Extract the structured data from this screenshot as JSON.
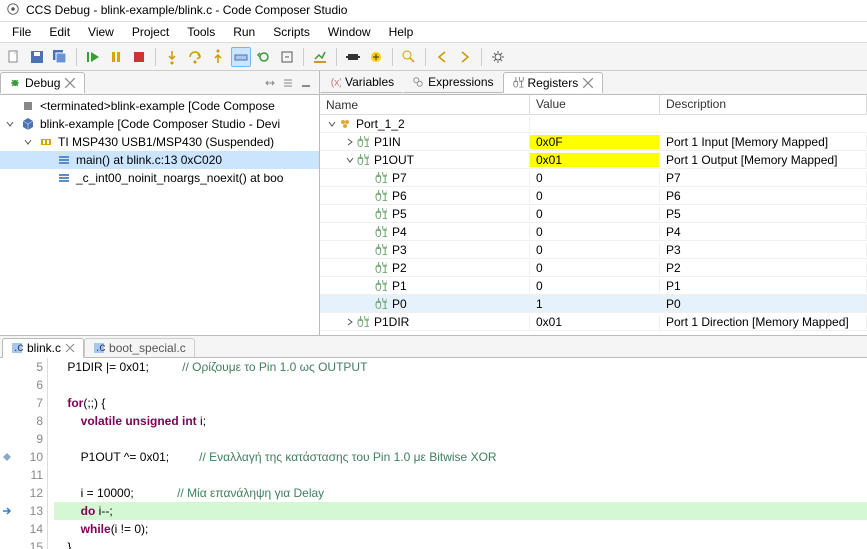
{
  "title": "CCS Debug - blink-example/blink.c - Code Composer Studio",
  "menu": [
    "File",
    "Edit",
    "View",
    "Project",
    "Tools",
    "Run",
    "Scripts",
    "Window",
    "Help"
  ],
  "debug_view": {
    "title": "Debug",
    "tree": [
      {
        "depth": 0,
        "chev": "",
        "icon": "cube-term",
        "label": "<terminated>blink-example [Code Compose"
      },
      {
        "depth": 0,
        "chev": "down",
        "icon": "cube",
        "label": "blink-example [Code Composer Studio - Devi"
      },
      {
        "depth": 1,
        "chev": "down",
        "icon": "chip-pause",
        "label": "TI MSP430 USB1/MSP430 (Suspended)"
      },
      {
        "depth": 2,
        "chev": "",
        "icon": "stack",
        "label": "main() at blink.c:13 0xC020",
        "selected": true
      },
      {
        "depth": 2,
        "chev": "",
        "icon": "stack",
        "label": "_c_int00_noinit_noargs_noexit() at boo"
      }
    ]
  },
  "vars_tabs": {
    "items": [
      {
        "label": "Variables",
        "icon": "vars"
      },
      {
        "label": "Expressions",
        "icon": "expr"
      },
      {
        "label": "Registers",
        "icon": "regs",
        "active": true
      }
    ]
  },
  "registers": {
    "cols": {
      "name": "Name",
      "value": "Value",
      "desc": "Description"
    },
    "rows": [
      {
        "depth": 0,
        "chev": "down",
        "icon": "group",
        "name": "Port_1_2",
        "value": "",
        "desc": ""
      },
      {
        "depth": 1,
        "chev": "right",
        "icon": "reg",
        "name": "P1IN",
        "value": "0x0F",
        "desc": "Port 1 Input [Memory Mapped]",
        "hl": true
      },
      {
        "depth": 1,
        "chev": "down",
        "icon": "reg",
        "name": "P1OUT",
        "value": "0x01",
        "desc": "Port 1 Output [Memory Mapped]",
        "hl": true
      },
      {
        "depth": 2,
        "icon": "reg",
        "name": "P7",
        "value": "0",
        "desc": "P7"
      },
      {
        "depth": 2,
        "icon": "reg",
        "name": "P6",
        "value": "0",
        "desc": "P6"
      },
      {
        "depth": 2,
        "icon": "reg",
        "name": "P5",
        "value": "0",
        "desc": "P5"
      },
      {
        "depth": 2,
        "icon": "reg",
        "name": "P4",
        "value": "0",
        "desc": "P4"
      },
      {
        "depth": 2,
        "icon": "reg",
        "name": "P3",
        "value": "0",
        "desc": "P3"
      },
      {
        "depth": 2,
        "icon": "reg",
        "name": "P2",
        "value": "0",
        "desc": "P2"
      },
      {
        "depth": 2,
        "icon": "reg",
        "name": "P1",
        "value": "0",
        "desc": "P1"
      },
      {
        "depth": 2,
        "icon": "reg",
        "name": "P0",
        "value": "1",
        "desc": "P0",
        "sel": true
      },
      {
        "depth": 1,
        "chev": "right",
        "icon": "reg",
        "name": "P1DIR",
        "value": "0x01",
        "desc": "Port 1 Direction [Memory Mapped]"
      }
    ]
  },
  "editor": {
    "tabs": [
      {
        "label": "blink.c",
        "active": true,
        "closable": true
      },
      {
        "label": "boot_special.c",
        "active": false
      }
    ],
    "first_line": 5,
    "lines": [
      {
        "n": 5,
        "mark": "",
        "tokens": [
          {
            "t": "    P1DIR |= 0x01;",
            "c": "op"
          },
          {
            "t": "          ",
            "c": ""
          },
          {
            "t": "// Ορίζουμε το Pin 1.0 ως OUTPUT",
            "c": "comment"
          }
        ]
      },
      {
        "n": 6,
        "mark": "",
        "tokens": [
          {
            "t": "",
            "c": ""
          }
        ]
      },
      {
        "n": 7,
        "mark": "",
        "tokens": [
          {
            "t": "    ",
            "c": ""
          },
          {
            "t": "for",
            "c": "kw"
          },
          {
            "t": "(;;) {",
            "c": "op"
          }
        ]
      },
      {
        "n": 8,
        "mark": "",
        "tokens": [
          {
            "t": "        ",
            "c": ""
          },
          {
            "t": "volatile unsigned int",
            "c": "kw"
          },
          {
            "t": " i;",
            "c": "op"
          }
        ]
      },
      {
        "n": 9,
        "mark": "",
        "tokens": [
          {
            "t": "",
            "c": ""
          }
        ]
      },
      {
        "n": 10,
        "mark": "diamond",
        "tokens": [
          {
            "t": "        P1OUT ^= 0x01;",
            "c": "op"
          },
          {
            "t": "         ",
            "c": ""
          },
          {
            "t": "// Εναλλαγή της κατάστασης του Pin 1.0 με Bitwise XOR",
            "c": "comment"
          }
        ]
      },
      {
        "n": 11,
        "mark": "",
        "tokens": [
          {
            "t": "",
            "c": ""
          }
        ]
      },
      {
        "n": 12,
        "mark": "",
        "tokens": [
          {
            "t": "        i = 10000;",
            "c": "op"
          },
          {
            "t": "             ",
            "c": ""
          },
          {
            "t": "// Μία επανάληψη για Delay",
            "c": "comment"
          }
        ]
      },
      {
        "n": 13,
        "mark": "arrow",
        "hl": true,
        "tokens": [
          {
            "t": "        ",
            "c": ""
          },
          {
            "t": "do",
            "c": "kw"
          },
          {
            "t": " i--;",
            "c": "op"
          }
        ]
      },
      {
        "n": 14,
        "mark": "",
        "tokens": [
          {
            "t": "        ",
            "c": ""
          },
          {
            "t": "while",
            "c": "kw"
          },
          {
            "t": "(i != 0);",
            "c": "op"
          }
        ]
      },
      {
        "n": 15,
        "mark": "",
        "tokens": [
          {
            "t": "    }",
            "c": "op"
          }
        ]
      }
    ]
  }
}
